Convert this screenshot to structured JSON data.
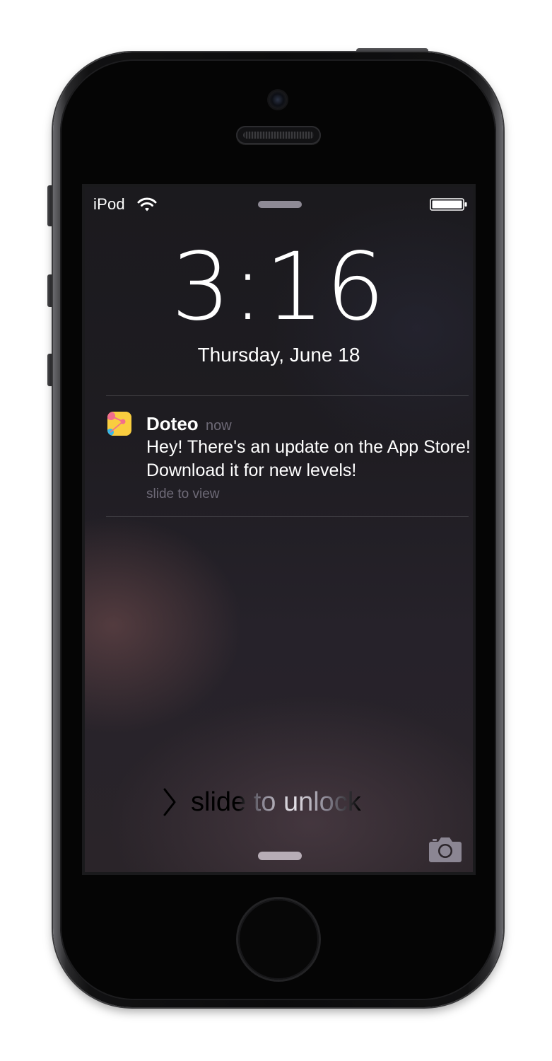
{
  "status_bar": {
    "carrier": "iPod",
    "wifi_icon": "wifi-icon",
    "battery_icon": "battery-full-icon"
  },
  "lock_screen": {
    "time": "3:16",
    "date": "Thursday, June 18"
  },
  "notification": {
    "app_name": "Doteo",
    "time": "now",
    "message": "Hey! There's an update on the App Store! Download it for new levels!",
    "action": "slide to view",
    "icon": "doteo-app-icon"
  },
  "unlock": {
    "label": "slide to unlock",
    "chevron_icon": "chevron-right-icon"
  },
  "camera": {
    "icon": "camera-icon"
  },
  "colors": {
    "app_icon_yellow": "#f9cd3f",
    "app_icon_pink": "#f26d8d",
    "app_icon_blue": "#39b8e8",
    "secondary_text": "#6e6a77"
  }
}
